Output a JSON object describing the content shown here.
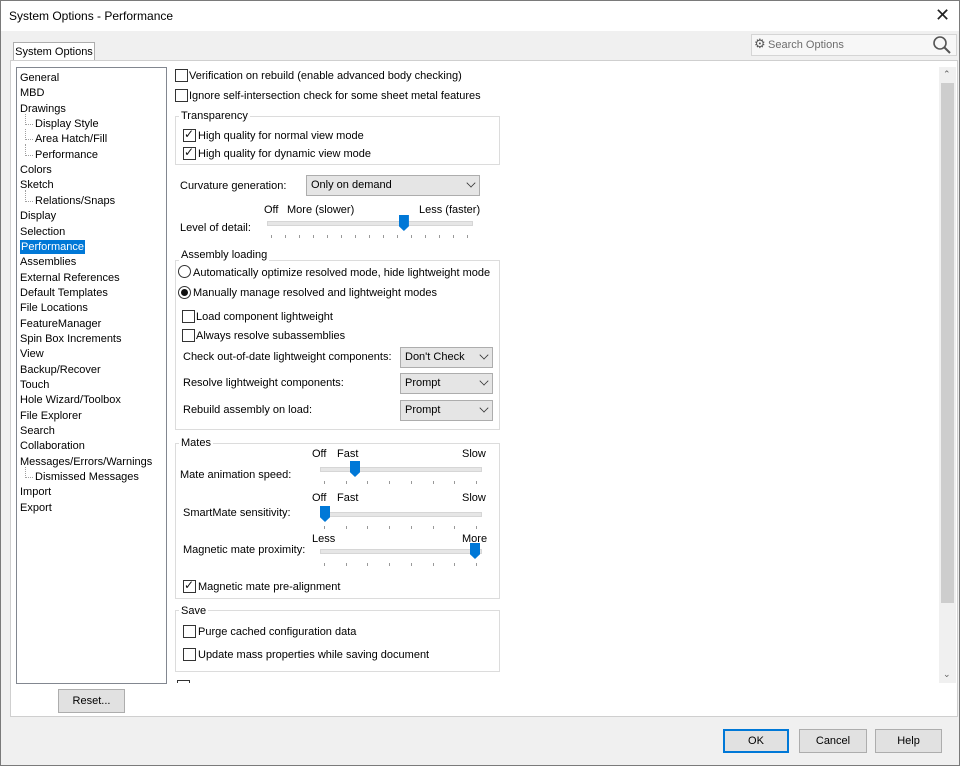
{
  "window": {
    "title": "System Options - Performance"
  },
  "tab": {
    "label": "System Options"
  },
  "search": {
    "placeholder": "Search Options"
  },
  "tree": {
    "items": [
      {
        "label": "General",
        "indent": 0
      },
      {
        "label": "MBD",
        "indent": 0
      },
      {
        "label": "Drawings",
        "indent": 0
      },
      {
        "label": "Display Style",
        "indent": 1
      },
      {
        "label": "Area Hatch/Fill",
        "indent": 1
      },
      {
        "label": "Performance",
        "indent": 1
      },
      {
        "label": "Colors",
        "indent": 0
      },
      {
        "label": "Sketch",
        "indent": 0
      },
      {
        "label": "Relations/Snaps",
        "indent": 1
      },
      {
        "label": "Display",
        "indent": 0
      },
      {
        "label": "Selection",
        "indent": 0
      },
      {
        "label": "Performance",
        "indent": 0,
        "selected": true
      },
      {
        "label": "Assemblies",
        "indent": 0
      },
      {
        "label": "External References",
        "indent": 0
      },
      {
        "label": "Default Templates",
        "indent": 0
      },
      {
        "label": "File Locations",
        "indent": 0
      },
      {
        "label": "FeatureManager",
        "indent": 0
      },
      {
        "label": "Spin Box Increments",
        "indent": 0
      },
      {
        "label": "View",
        "indent": 0
      },
      {
        "label": "Backup/Recover",
        "indent": 0
      },
      {
        "label": "Touch",
        "indent": 0
      },
      {
        "label": "Hole Wizard/Toolbox",
        "indent": 0
      },
      {
        "label": "File Explorer",
        "indent": 0
      },
      {
        "label": "Search",
        "indent": 0
      },
      {
        "label": "Collaboration",
        "indent": 0
      },
      {
        "label": "Messages/Errors/Warnings",
        "indent": 0
      },
      {
        "label": "Dismissed Messages",
        "indent": 1
      },
      {
        "label": "Import",
        "indent": 0
      },
      {
        "label": "Export",
        "indent": 0
      }
    ]
  },
  "options": {
    "verification": "Verification on rebuild (enable advanced body checking)",
    "ignore_self_intersection": "Ignore self-intersection check for some sheet metal features",
    "transparency": {
      "title": "Transparency",
      "normal": "High quality for normal view mode",
      "dynamic": "High quality for dynamic view mode"
    },
    "curvature": {
      "label": "Curvature generation:",
      "value": "Only on demand"
    },
    "detail": {
      "label": "Level of detail:",
      "off": "Off",
      "more": "More (slower)",
      "less": "Less (faster)",
      "level": 0.68
    },
    "assembly": {
      "title": "Assembly loading",
      "auto": "Automatically optimize resolved mode, hide lightweight mode",
      "manual": "Manually manage resolved and lightweight modes",
      "load_lightweight": "Load component lightweight",
      "always_resolve": "Always resolve subassemblies",
      "check_label": "Check out-of-date lightweight components:",
      "check_value": "Don't Check",
      "resolve_label": "Resolve lightweight components:",
      "resolve_value": "Prompt",
      "rebuild_label": "Rebuild assembly on load:",
      "rebuild_value": "Prompt"
    },
    "mates": {
      "title": "Mates",
      "anim_label": "Mate animation speed:",
      "anim_off": "Off",
      "anim_fast": "Fast",
      "anim_slow": "Slow",
      "anim_level": 0.2,
      "smart_label": "SmartMate sensitivity:",
      "smart_off": "Off",
      "smart_fast": "Fast",
      "smart_slow": "Slow",
      "smart_level": 0.0,
      "mag_label": "Magnetic mate proximity:",
      "mag_less": "Less",
      "mag_more": "More",
      "mag_level": 1.0,
      "prealign": "Magnetic mate pre-alignment"
    },
    "save": {
      "title": "Save",
      "purge": "Purge cached configuration data",
      "update_mass": "Update mass properties while saving document"
    }
  },
  "buttons": {
    "reset": "Reset...",
    "ok": "OK",
    "cancel": "Cancel",
    "help": "Help"
  },
  "colors": {
    "accent": "#0078d7"
  }
}
